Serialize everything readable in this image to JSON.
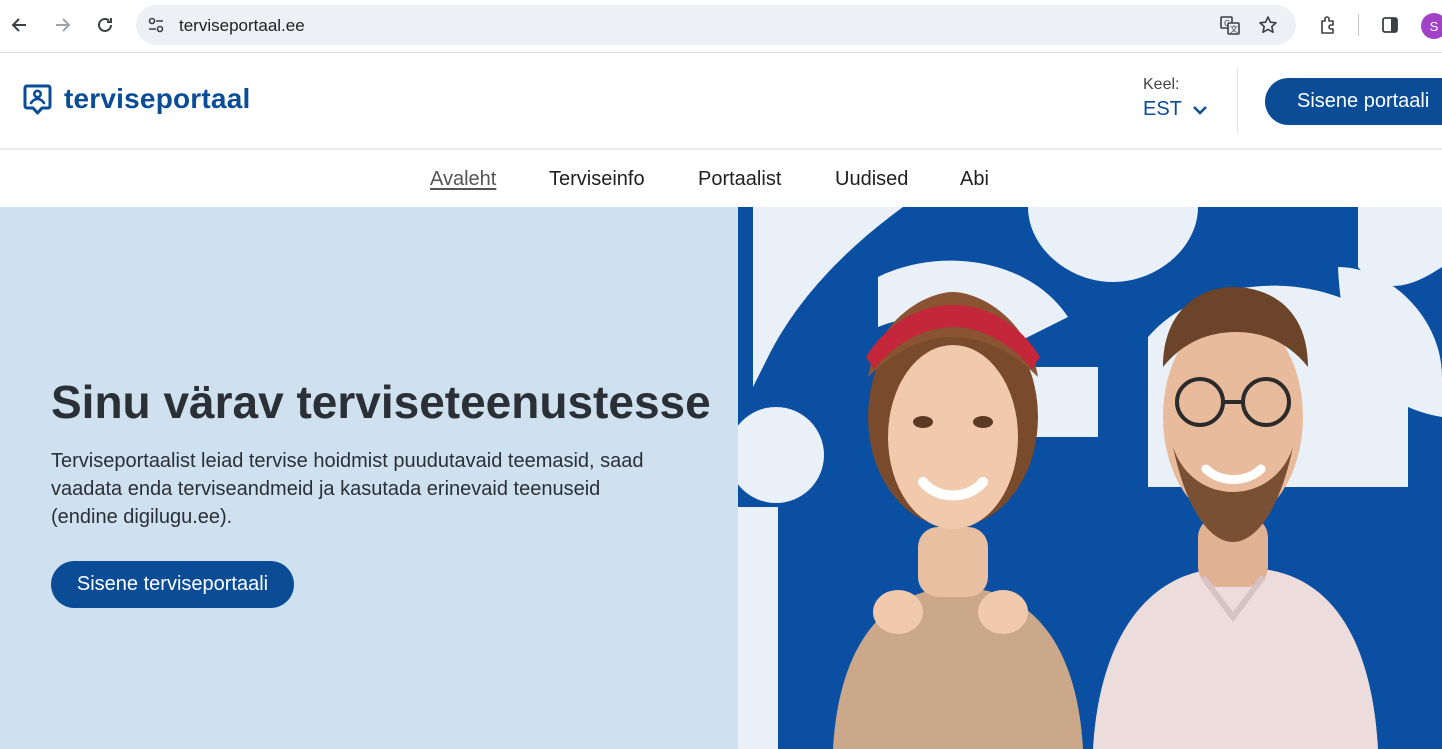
{
  "browser": {
    "url": "terviseportaal.ee",
    "profile_initial": "S"
  },
  "header": {
    "logo_text": "terviseportaal",
    "lang_label": "Keel:",
    "lang_value": "EST",
    "enter_button": "Sisene portaali"
  },
  "nav": {
    "items": [
      {
        "label": "Avaleht",
        "active": true
      },
      {
        "label": "Terviseinfo"
      },
      {
        "label": "Portaalist"
      },
      {
        "label": "Uudised"
      },
      {
        "label": "Abi"
      }
    ]
  },
  "hero": {
    "title": "Sinu värav terviseteenustesse",
    "text": "Terviseportaalist leiad tervise hoidmist puudutavaid teemasid, saad vaadata enda terviseandmeid ja kasutada erinevaid teenuseid (endine digilugu.ee).",
    "button": "Sisene terviseportaali"
  },
  "colors": {
    "brand": "#0a4d96",
    "hero_bg": "#cfe0ef",
    "image_bg": "#0a4fa1"
  }
}
